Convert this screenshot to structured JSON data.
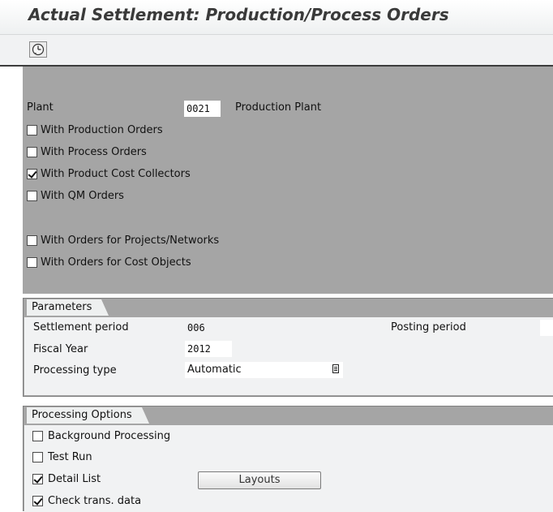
{
  "window": {
    "title": "Actual Settlement: Production/Process Orders"
  },
  "toolbar": {
    "execute_icon": "execute-clock-icon"
  },
  "selection": {
    "plant_label": "Plant",
    "plant_value": "0021",
    "plant_desc": "Production Plant",
    "options": [
      {
        "label": "With Production Orders",
        "checked": false
      },
      {
        "label": "With Process Orders",
        "checked": false
      },
      {
        "label": "With Product Cost Collectors",
        "checked": true
      },
      {
        "label": "With QM Orders",
        "checked": false
      }
    ],
    "options2": [
      {
        "label": "With Orders for Projects/Networks",
        "checked": false
      },
      {
        "label": "With Orders for Cost Objects",
        "checked": false
      }
    ]
  },
  "parameters": {
    "tab_label": "Parameters",
    "settlement_period_label": "Settlement period",
    "settlement_period_value": "006",
    "posting_period_label": "Posting period",
    "posting_period_value": "",
    "fiscal_year_label": "Fiscal Year",
    "fiscal_year_value": "2012",
    "processing_type_label": "Processing type",
    "processing_type_value": "Automatic"
  },
  "processing_options": {
    "tab_label": "Processing Options",
    "background_label": "Background Processing",
    "background_checked": false,
    "test_run_label": "Test Run",
    "test_run_checked": false,
    "detail_list_label": "Detail List",
    "detail_list_checked": true,
    "layouts_label": "Layouts",
    "check_trans_label": "Check trans. data",
    "check_trans_checked": true
  }
}
